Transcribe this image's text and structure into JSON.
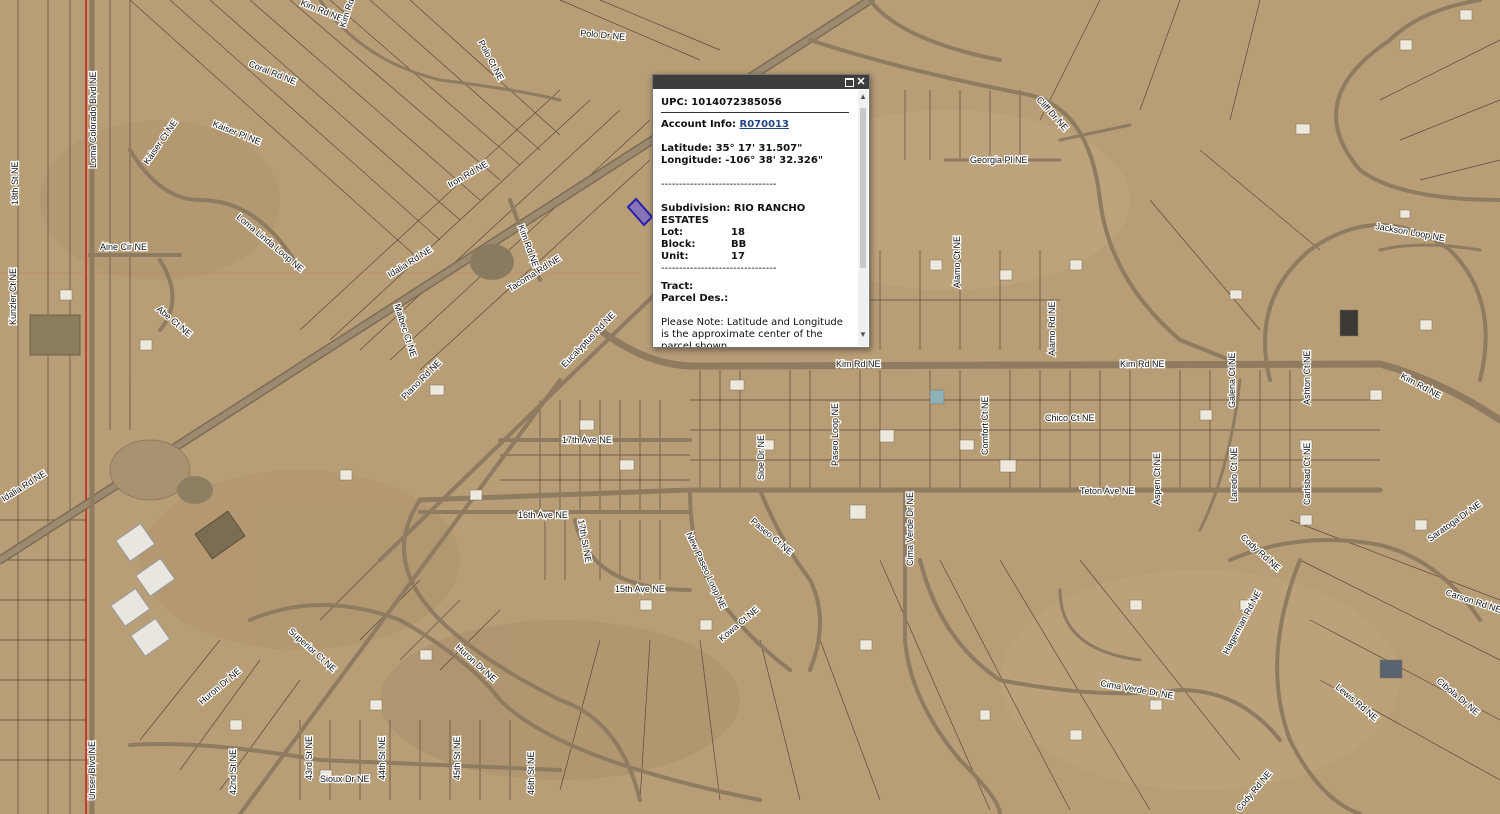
{
  "map": {
    "colors": {
      "terrain": "#b89e77",
      "road": "#8c7a60",
      "road_edge": "#6c5c46",
      "parcel": "#3a2f24",
      "highlight": "#4b44c8",
      "boundary": "#c93a30"
    },
    "labels": {
      "kim_rd_top": "Kim Rd NE",
      "polo_dr": "Polo Dr NE",
      "polo_ct": "Polo Ct NE",
      "coral_rd": "Coral Rd NE",
      "kaiser_pl": "Kaiser Pl NE",
      "kaiser_ct": "Kaiser Ct NE",
      "iron_rd": "Iron Rd NE",
      "loma_colorado": "Loma Colorado Blvd NE",
      "loma_linda_loop": "Loma Linda Loop NE",
      "aine_cir": "Aine Cir NE",
      "abe_ct": "Abe Ct NE",
      "kim_rd_mid": "Kim Rd NE",
      "tacoma_rd": "Tacoma Rd NE",
      "idalia_rd_mid": "Idalia Rd NE",
      "malbec_ct": "Malbec Ct NE",
      "piano_rd": "Piano Rd NE",
      "eucalyptus_rd": "Eucalyptus Rd NE",
      "idalia_rd_left": "Idalia Rd NE",
      "ave_17th": "17th Ave NE",
      "ave_16th": "16th Ave NE",
      "ave_15th": "15th Ave NE",
      "st_17th": "17th St NE",
      "kim_rd_main": "Kim Rd NE",
      "kim_rd_main2": "Kim Rd NE",
      "kim_rd_right": "Kim Rd NE",
      "clift_dr": "Cliff Dr NE",
      "georgia_pl": "Georgia Pl NE",
      "jackson_loop": "Jackson Loop NE",
      "chico_ct": "Chico Ct NE",
      "teton_ave": "Teton Ave NE",
      "cody_rd": "Cody Rd NE",
      "saratoga_dr": "Saratoga Dr NE",
      "carson_rd": "Carson Rd NE",
      "cibola_dr": "Cibola Dr NE",
      "lewis_rd": "Lewis Rd NE",
      "hagerman_rd": "Hagerman Rd NE",
      "cima_verde_dr": "Cima Verde Dr NE",
      "cima_verde_dr2": "Cima Verde Dr NE",
      "paseo_loop": "Paseo Loop NE",
      "new_paseo_loop": "New Paseo Loop NE",
      "sloe_dr": "Sloe Dr NE",
      "paseo_ct": "Paseo Ct NE",
      "alamo_ct": "Alamo Ct NE",
      "kowa_ct": "Kowa Ct NE",
      "aspen_ct": "Aspen Ct NE",
      "comfort_ct": "Comfort Ct NE",
      "galena_ct": "Galena Ct NE",
      "alamo_rd": "Alamo Rd NE",
      "superior_ct": "Superior Ct NE",
      "huron_dr": "Huron Dr NE",
      "huron_ct": "Huron Dr NE",
      "sioux_dr": "Sioux Dr NE",
      "st_43rd": "43rd St NE",
      "st_44th": "44th St NE",
      "st_45th": "45th St NE",
      "st_46th": "46th St NE",
      "st_42nd": "42nd St NE",
      "unser": "Unser Blvd NE",
      "st_left1": "18th St NE",
      "st_left2": "Kunzler Ct NE",
      "alpine": "Alpine Ct NE",
      "cody_rd2": "Cody Rd NE",
      "cougar_ct": "Cougar Ct NE",
      "juan_ct": "Juan Ct NE",
      "jesse": "Jesse Ct NE",
      "ashton": "Ashton Ct NE",
      "galveston": "Galveston Rd NE",
      "lucas": "Lucas Ct NE",
      "laredo": "Laredo Ct NE",
      "carlsbad": "Carlsbad Ct NE",
      "linda": "Linda Ct NE",
      "kobe": "Kobe Ct NE"
    }
  },
  "popup": {
    "upc_label": "UPC:",
    "upc_value": "1014072385056",
    "account_label": "Account Info:",
    "account_link": "R070013",
    "latitude_label": "Latitude:",
    "latitude_value": "35° 17' 31.507\"",
    "longitude_label": "Longitude:",
    "longitude_value": "-106° 38' 32.326\"",
    "divider": "--------------------------------",
    "subdivision_label": "Subdivision:",
    "subdivision_value": "RIO RANCHO ESTATES",
    "lot_label": "Lot:",
    "lot_value": "18",
    "block_label": "Block:",
    "block_value": "BB",
    "unit_label": "Unit:",
    "unit_value": "17",
    "tract_label": "Tract:",
    "tract_value": "",
    "parcel_des_label": "Parcel Des.:",
    "parcel_des_value": "",
    "note": "Please Note: Latitude and Longitude is the approximate center of the parcel shown.",
    "close_symbol": "✕",
    "scroll_up": "▲",
    "scroll_down": "▼"
  }
}
